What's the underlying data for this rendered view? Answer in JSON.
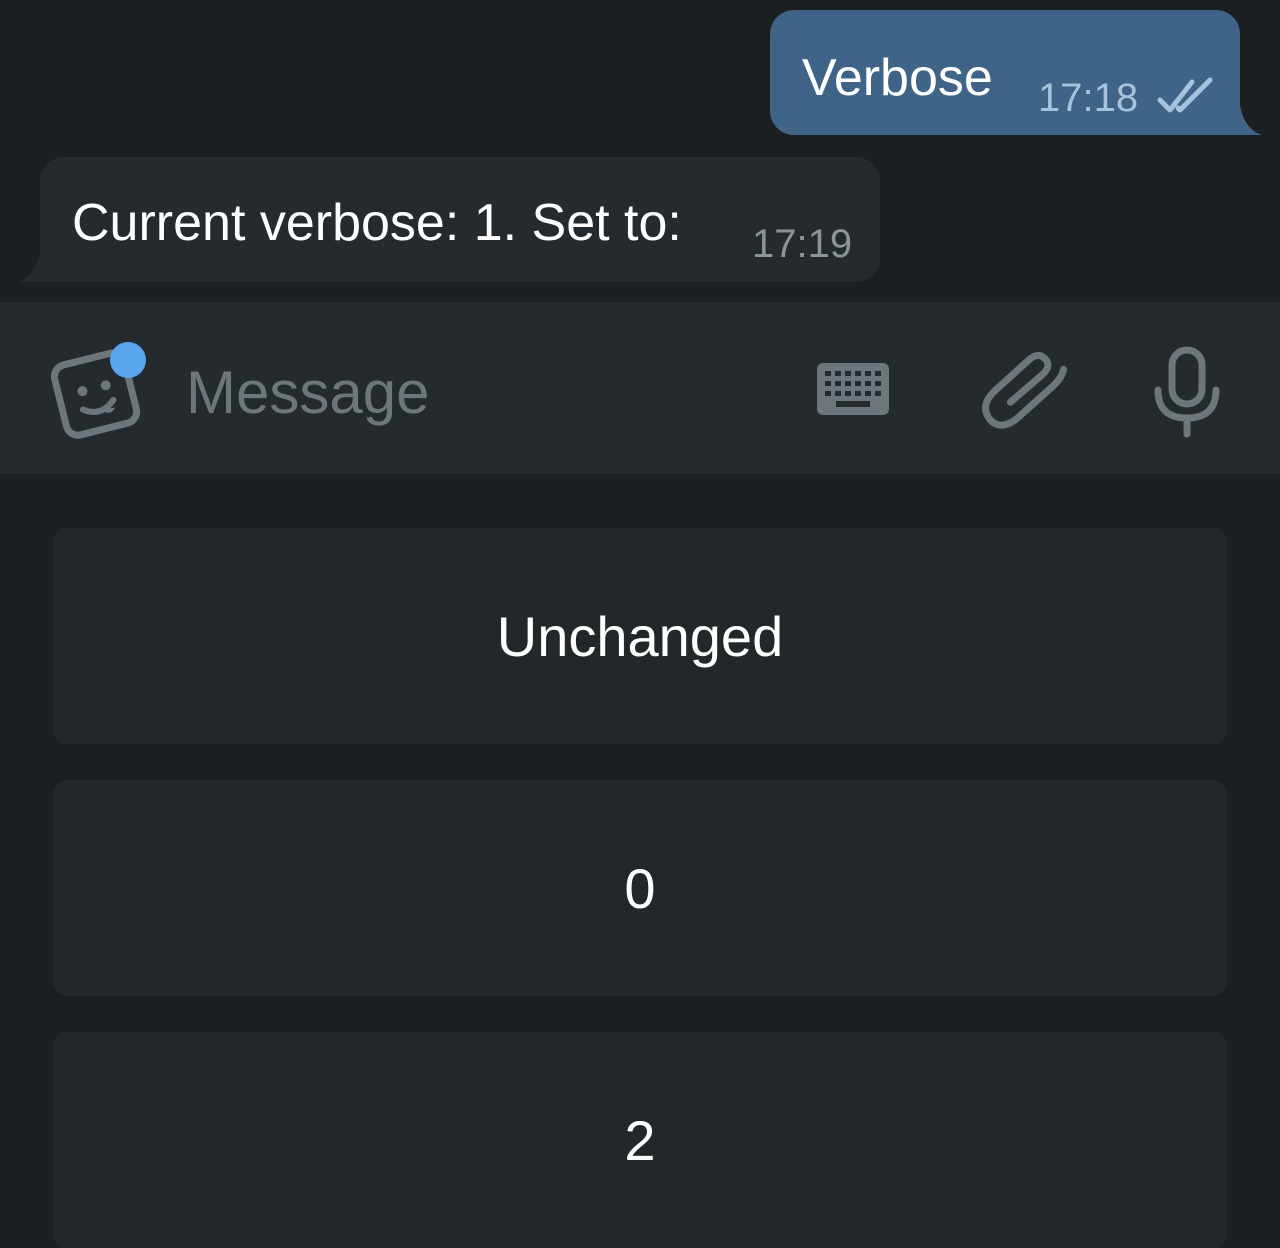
{
  "colors": {
    "background": "#1b1f21",
    "outgoing_bubble": "#3f6488",
    "incoming_bubble": "#242a2e",
    "composer": "#242a2d",
    "keyboard_button": "#222829",
    "accent_dot": "#5aa6ec",
    "icon": "#6c767b"
  },
  "messages": [
    {
      "direction": "outgoing",
      "text": "Verbose",
      "time": "17:18",
      "status_icon": "double-check-icon"
    },
    {
      "direction": "incoming",
      "text": "Current verbose: 1. Set to:",
      "time": "17:19"
    }
  ],
  "composer": {
    "placeholder": "Message",
    "icons": [
      "sticker-icon",
      "keyboard-icon",
      "paperclip-icon",
      "microphone-icon"
    ]
  },
  "reply_keyboard": {
    "buttons": [
      "Unchanged",
      "0",
      "2"
    ]
  }
}
